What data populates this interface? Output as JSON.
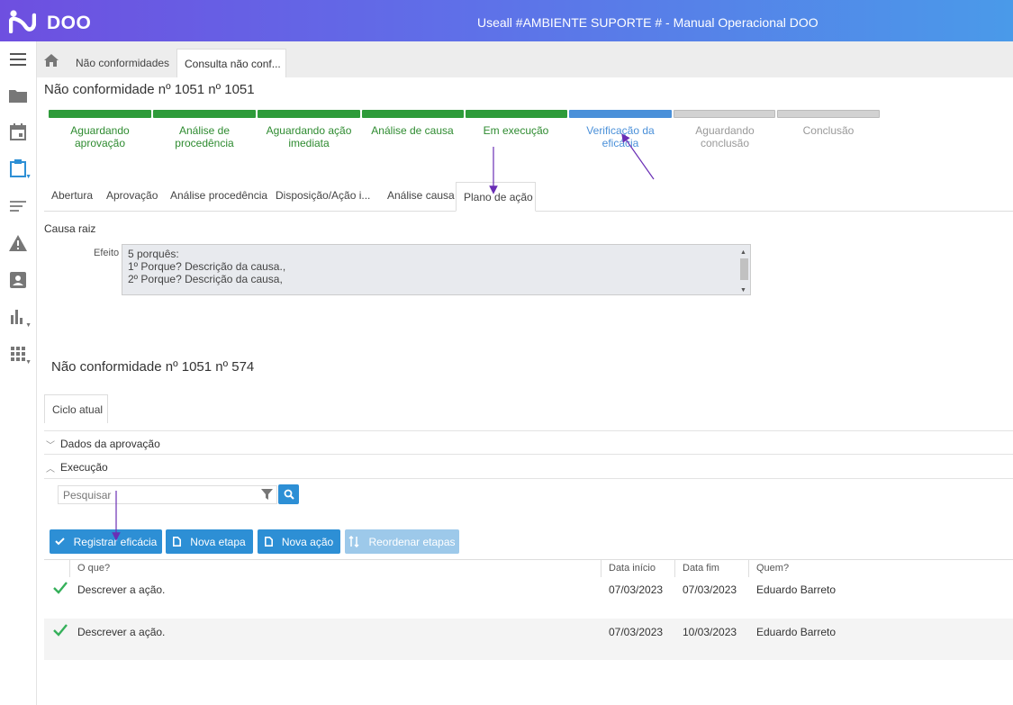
{
  "app": {
    "logo_text": "DOO",
    "window_title": "Useall #AMBIENTE SUPORTE # - Manual Operacional DOO"
  },
  "breadcrumbs": {
    "item1": "Não conformidades",
    "tab": "Consulta não conf..."
  },
  "page_title": "Não conformidade nº 1051 nº 1051",
  "steps": [
    {
      "label": "Aguardando aprovação",
      "status": "done"
    },
    {
      "label": "Análise de procedência",
      "status": "done"
    },
    {
      "label": "Aguardando ação imediata",
      "status": "done"
    },
    {
      "label": "Análise de causa",
      "status": "done"
    },
    {
      "label": "Em execução",
      "status": "done"
    },
    {
      "label": "Verificação da eficácia",
      "status": "current"
    },
    {
      "label": "Aguardando conclusão",
      "status": "pending"
    },
    {
      "label": "Conclusão",
      "status": "pending"
    }
  ],
  "colors": {
    "done": "#2e9b3a",
    "current": "#4a90d9",
    "pending": "#cccccc",
    "accent": "#2d8fd5",
    "arrow": "#6a2fb5"
  },
  "tabs": [
    "Abertura",
    "Aprovação",
    "Análise procedência",
    "Disposição/Ação i...",
    "Análise causa",
    "Plano de ação"
  ],
  "root_cause": {
    "section_label": "Causa raiz",
    "field_label": "Efeito",
    "lines": [
      "5 porquês:",
      "1º Porque? Descrição da causa.,",
      "2º Porque? Descrição da causa,"
    ]
  },
  "sub_title": "Não conformidade nº 1051 nº 574",
  "cycle_tab": "Ciclo atual",
  "accordion": {
    "approval": "Dados da aprovação",
    "execution": "Execução"
  },
  "search": {
    "placeholder": "Pesquisar"
  },
  "buttons": {
    "register": "Registrar eficácia",
    "new_stage": "Nova etapa",
    "new_action": "Nova ação",
    "reorder": "Reordenar etapas"
  },
  "table": {
    "headers": {
      "what": "O que?",
      "start": "Data início",
      "end": "Data fim",
      "who": "Quem?"
    },
    "rows": [
      {
        "what": "Descrever a ação.",
        "start": "07/03/2023",
        "end": "07/03/2023",
        "who": "Eduardo Barreto"
      },
      {
        "what": "Descrever a ação.",
        "start": "07/03/2023",
        "end": "10/03/2023",
        "who": "Eduardo Barreto"
      }
    ]
  }
}
